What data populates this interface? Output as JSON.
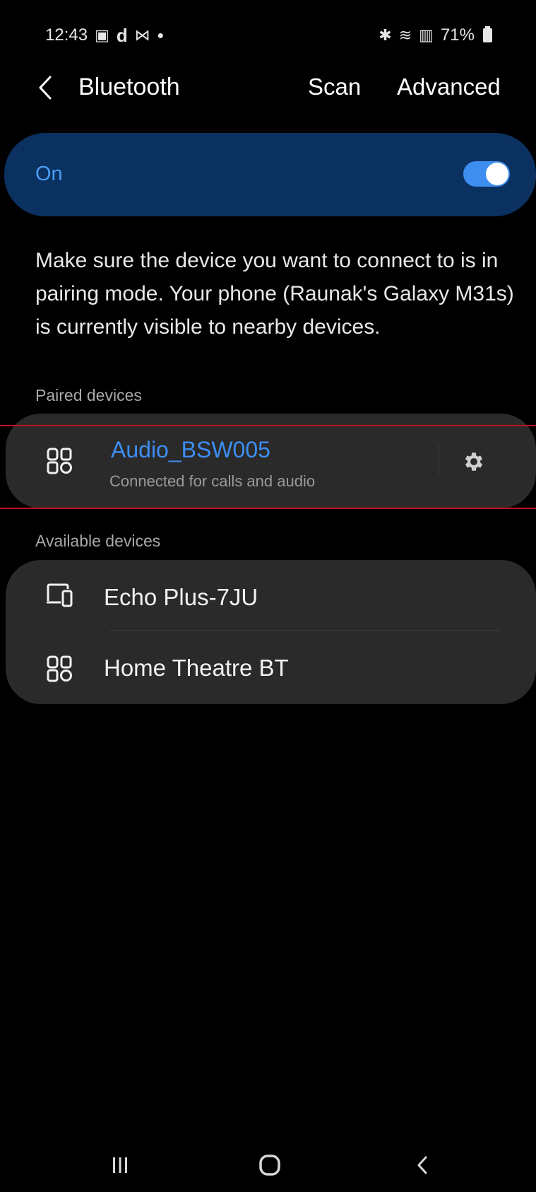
{
  "status_bar": {
    "time": "12:43",
    "left_glyphs": [
      "▣",
      "d",
      "⋈",
      "•"
    ],
    "right_glyphs": [
      "✱",
      "≋",
      "▥",
      "▮"
    ],
    "battery_percent": "71%",
    "icons": [
      "gallery-notification-icon",
      "d-app-notification-icon",
      "mail-notification-icon",
      "bluetooth-status-icon",
      "wifi-icon",
      "signal-icon",
      "battery-icon"
    ]
  },
  "header": {
    "title": "Bluetooth",
    "scan_label": "Scan",
    "advanced_label": "Advanced"
  },
  "toggle": {
    "label": "On",
    "state": true,
    "accent_color": "#3e8ef0",
    "card_color": "#0b3160"
  },
  "description": "Make sure the device you want to connect to is in pairing mode. Your phone (Raunak's Galaxy M31s) is currently visible to nearby devices.",
  "paired_devices": {
    "section_label": "Paired devices",
    "items": [
      {
        "name": "Audio_BSW005",
        "status": "Connected for calls and audio",
        "icon": "device-generic-icon"
      }
    ]
  },
  "available_devices": {
    "section_label": "Available devices",
    "items": [
      {
        "name": "Echo Plus-7JU",
        "icon": "computer-phone-icon"
      },
      {
        "name": "Home Theatre BT",
        "icon": "device-generic-icon"
      }
    ]
  },
  "nav_bar": {
    "buttons": [
      "recents-icon",
      "home-icon",
      "back-icon"
    ]
  }
}
